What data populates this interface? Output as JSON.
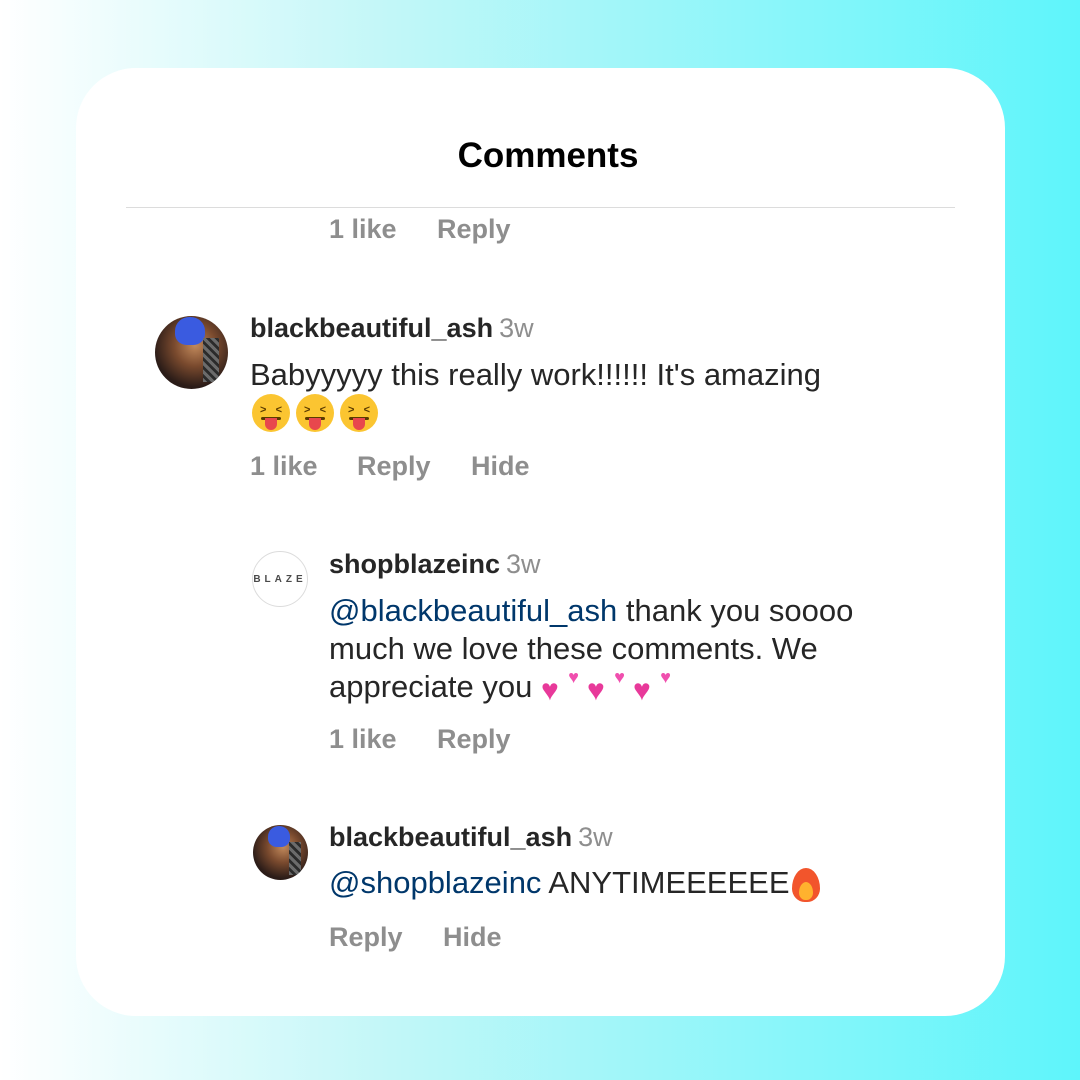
{
  "header": {
    "title": "Comments"
  },
  "top_actions": {
    "likes": "1 like",
    "reply": "Reply"
  },
  "comments": [
    {
      "username": "blackbeautiful_ash",
      "time": "3w",
      "text": "Babyyyyy this really work!!!!!! It's amazing",
      "emoji": [
        "squinting-face-with-tongue",
        "squinting-face-with-tongue",
        "squinting-face-with-tongue"
      ],
      "likes": "1 like",
      "reply": "Reply",
      "hide": "Hide"
    },
    {
      "username": "shopblazeinc",
      "avatar_text": "BLAZE",
      "time": "3w",
      "mention": "@blackbeautiful_ash",
      "text_line1": " thank you soooo",
      "text_line2": "much we love these comments. We",
      "text_line3": "appreciate you ",
      "emoji": [
        "two-hearts",
        "two-hearts",
        "two-hearts"
      ],
      "likes": "1 like",
      "reply": "Reply"
    },
    {
      "username": "blackbeautiful_ash",
      "time": "3w",
      "mention": "@shopblazeinc",
      "text": " ANYTIMEEEEEE",
      "emoji": [
        "fire"
      ],
      "reply": "Reply",
      "hide": "Hide"
    }
  ],
  "colors": {
    "mention": "#00376b",
    "muted": "#8e8e8e",
    "text": "#262626",
    "card": "#ffffff"
  }
}
